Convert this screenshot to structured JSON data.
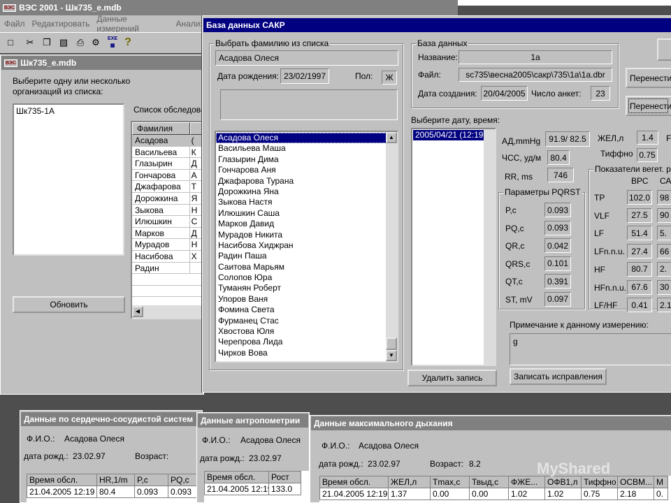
{
  "app": {
    "title": "ВЭС 2001 - Шк735_е.mdb",
    "icon_text": "ВЭС"
  },
  "menu": [
    "Файл",
    "Редактировать",
    "Данные измерений",
    "Анализ"
  ],
  "toolbar": {
    "icons": [
      "new-icon",
      "cut-icon",
      "copy-icon",
      "paste-icon",
      "print-icon",
      "stamp-icon",
      "export-icon",
      "grid-icon",
      "help-icon"
    ],
    "export_text": "EXE"
  },
  "mdi": {
    "title": "Шк735_е.mdb",
    "prompt": "Выберите одну или несколько организаций из списка:",
    "orgs": [
      "Шк735-1А"
    ],
    "list_label": "Список обследованных",
    "col_header": "Фамилия",
    "surnames": [
      "Асадова",
      "Васильева",
      "Глазырин",
      "Гончарова",
      "Джафарова",
      "Дорожкина",
      "Зыкова",
      "Илюшкин",
      "Марков",
      "Мурадов",
      "Насибова",
      "Радин"
    ],
    "col2": [
      "(",
      "К",
      "Д",
      "А",
      "Т",
      "Я",
      "Н",
      "С",
      "Д",
      "Н",
      "Х",
      ""
    ],
    "refresh": "Обновить"
  },
  "dialog": {
    "title": "База данных САКР",
    "choose_group": "Выбрать фамилию из списка",
    "selected_name": "Асадова Олеся",
    "dob_label": "Дата рождения:",
    "dob": "23/02/1997",
    "sex_label": "Пол:",
    "sex": "Ж",
    "names": [
      "Асадова Олеся",
      "Васильева Маша",
      "Глазырин Дима",
      "Гончарова Аня",
      "Джафарова Турана",
      "Дорожкина Яна",
      "Зыкова Настя",
      "Илюшкин Саша",
      "Марков Давид",
      "Мурадов Никита",
      "Насибова Хиджран",
      "Радин Паша",
      "Саитова Марьям",
      "Солопов Юра",
      "Туманян Роберт",
      "Упоров Ваня",
      "Фомина Света",
      "Фурманец Стас",
      "Хвостова Юля",
      "Черепрова Лида",
      "Чирков Вова"
    ],
    "db_group": "База данных",
    "name_label": "Название:",
    "name_val": "1а",
    "file_label": "Файл:",
    "file_val": "sc735\\весна2005\\сакр\\735\\1а\\1а.dbr",
    "created_label": "Дата создания:",
    "created_val": "20/04/2005",
    "count_label": "Число анкет:",
    "count_val": "23",
    "date_label": "Выберите дату, время:",
    "dates": [
      "2005/04/21 (12:19)"
    ],
    "ad_label": "АД,mmHg",
    "ad_val": "91.9/ 82.5",
    "hr_label": "ЧСС, уд/м",
    "hr_val": "80.4",
    "rr_label": "RR, ms",
    "rr_val": "746",
    "zhel_label": "ЖЕЛ,л",
    "zhel_val": "1.4",
    "tif_label": "Тиффно",
    "tif_val": "0.75",
    "pqrst_group": "Параметры PQRST",
    "pqrst": [
      {
        "k": "P,c",
        "v": "0.093"
      },
      {
        "k": "PQ,c",
        "v": "0.093"
      },
      {
        "k": "QR,c",
        "v": "0.042"
      },
      {
        "k": "QRS,c",
        "v": "0.101"
      },
      {
        "k": "QT,c",
        "v": "0.391"
      },
      {
        "k": "ST, mV",
        "v": "0.097"
      }
    ],
    "veg_group": "Показатели вегет. ре",
    "veg_h1": "ВРС",
    "veg_h2": "СА",
    "veg": [
      {
        "k": "TP",
        "v": "102.0",
        "c": "98"
      },
      {
        "k": "VLF",
        "v": "27.5",
        "c": "90"
      },
      {
        "k": "LF",
        "v": "51.4",
        "c": "5."
      },
      {
        "k": "LFn.n.u.",
        "v": "27.4",
        "c": "66"
      },
      {
        "k": "HF",
        "v": "80.7",
        "c": "2."
      },
      {
        "k": "HFn.n.u.",
        "v": "67.6",
        "c": "30"
      },
      {
        "k": "LF/HF",
        "v": "0.41",
        "c": "2.1"
      }
    ],
    "note_label": "Примечание к данному измерению:",
    "note_val": "g",
    "btn_delete": "Удалить запись",
    "btn_save": "Записать исправления",
    "btn_transfer1": "Перенести",
    "btn_transfer2": "Перенести"
  },
  "cardio": {
    "title": "Данные по сердечно-сосудистой систем",
    "fio_label": "Ф.И.О.:",
    "fio": "Асадова Олеся",
    "dob_label": "дата рожд.:",
    "dob": "23.02.97",
    "age_label": "Возраст:",
    "cols": [
      "Время обсл.",
      "HR,1/m",
      "P,c",
      "PQ,c"
    ],
    "row": [
      "21.04.2005 12:19",
      "80.4",
      "0.093",
      "0.093"
    ]
  },
  "anthro": {
    "title": "Данные антропометрии",
    "fio_label": "Ф.И.О.:",
    "fio": "Асадова Олеся",
    "dob_label": "дата рожд.:",
    "dob": "23.02.97",
    "cols": [
      "Время обсл.",
      "Рост"
    ],
    "row": [
      "21.04.2005 12:19",
      "133.0"
    ]
  },
  "breath": {
    "title": "Данные максимального дыхания",
    "fio_label": "Ф.И.О.:",
    "fio": "Асадова Олеся",
    "dob_label": "дата рожд.:",
    "dob": "23.02.97",
    "age_label": "Возраст:",
    "age": "8.2",
    "cols": [
      "Время обсл.",
      "ЖЕЛ,л",
      "Tmax,c",
      "Твыд,c",
      "ФЖЕ...",
      "ОФВ1,л",
      "Тиффно",
      "ОСВМ...",
      "М"
    ],
    "row": [
      "21.04.2005 12:19",
      "1.37",
      "0.00",
      "0.00",
      "1.02",
      "1.02",
      "0.75",
      "2.18",
      "0."
    ]
  },
  "watermark": "MyShared"
}
